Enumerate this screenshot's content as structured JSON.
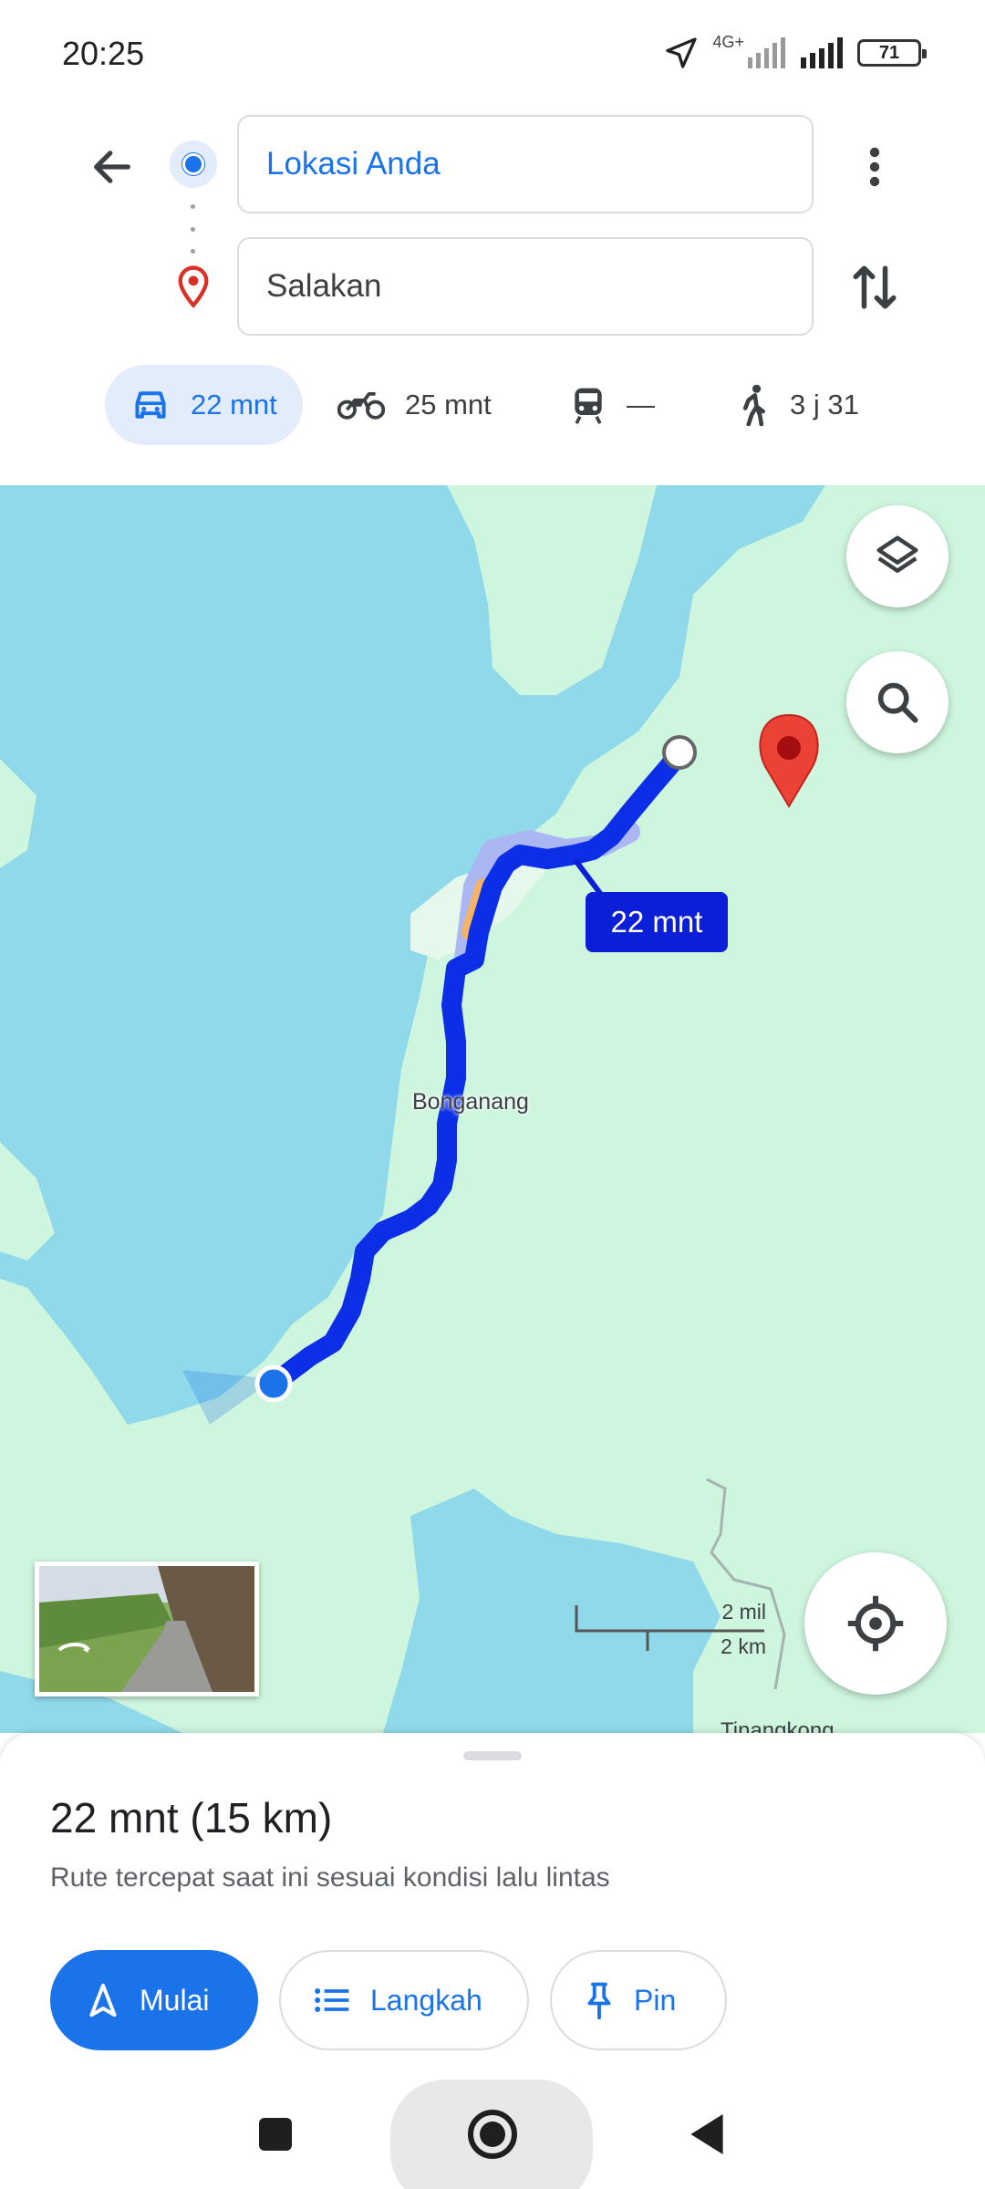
{
  "status_bar": {
    "time": "20:25",
    "network": "4G+",
    "battery": "71",
    "icons": [
      "location-arrow-icon",
      "signal-icon",
      "signal-icon",
      "battery-icon"
    ]
  },
  "directions": {
    "origin_value": "Lokasi Anda",
    "destination_value": "Salakan",
    "modes": [
      {
        "name": "car",
        "icon": "car-icon",
        "label": "22 mnt",
        "selected": true
      },
      {
        "name": "motorcycle",
        "icon": "motorcycle-icon",
        "label": "25 mnt",
        "selected": false
      },
      {
        "name": "transit",
        "icon": "train-icon",
        "label": "—",
        "selected": false
      },
      {
        "name": "walk",
        "icon": "walking-icon",
        "label": "3 j 31",
        "selected": false
      }
    ]
  },
  "map": {
    "route_time_label": "22 mnt",
    "place_label": "Bonganang",
    "place_label_bottom": "Tinangkong",
    "scale_miles": "2 mil",
    "scale_km": "2 km",
    "colors": {
      "water": "#8fd9ea",
      "land": "#cef5de",
      "route": "#0b2ee6",
      "alt_route": "#aab7f2",
      "pin": "#ea4335"
    }
  },
  "sheet": {
    "summary": "22 mnt (15 km)",
    "description": "Rute tercepat saat ini sesuai kondisi lalu lintas",
    "start_label": "Mulai",
    "steps_label": "Langkah",
    "pin_label": "Pin"
  }
}
